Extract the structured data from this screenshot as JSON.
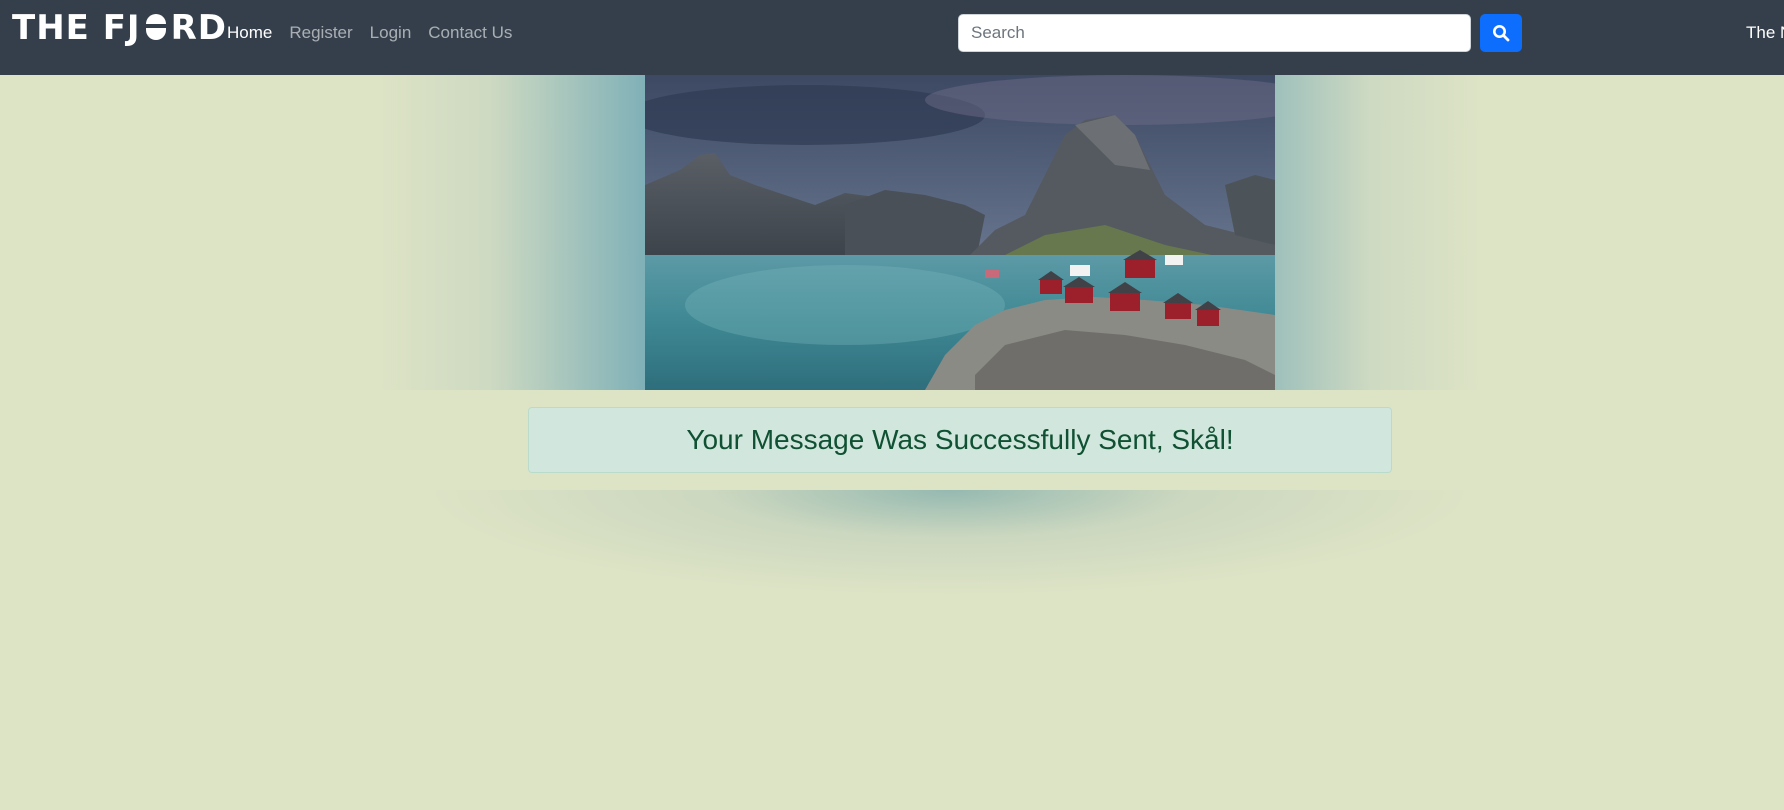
{
  "navbar": {
    "brand": "THE FJ",
    "brand_suffix": "RD",
    "links": [
      {
        "label": "Home",
        "active": true
      },
      {
        "label": "Register",
        "active": false
      },
      {
        "label": "Login",
        "active": false
      },
      {
        "label": "Contact Us",
        "active": false
      }
    ],
    "search": {
      "placeholder": "Search",
      "value": "",
      "button_icon": "search-icon"
    },
    "right_text": "The N"
  },
  "hero": {
    "image": "norwegian-fjord-village-photo"
  },
  "alert": {
    "message": "Your Message Was Successfully Sent, Skål!",
    "type": "success"
  },
  "colors": {
    "navbar_bg": "#343f4b",
    "page_bg": "#dde3c5",
    "primary": "#0d6efd",
    "alert_bg": "#d1e7dd",
    "alert_text": "#0f5132"
  }
}
